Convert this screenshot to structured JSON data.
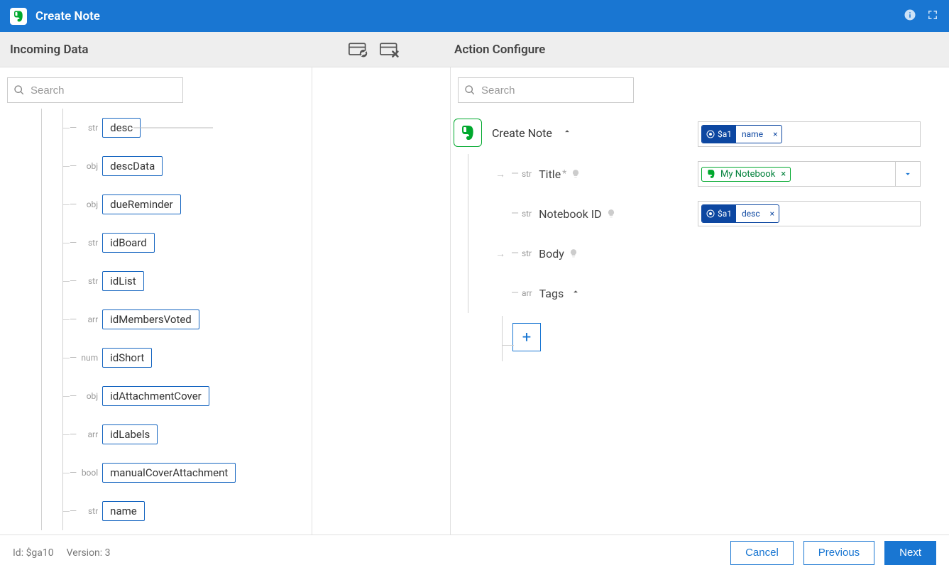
{
  "titlebar": {
    "title": "Create Note"
  },
  "sections": {
    "incoming": "Incoming Data",
    "configure": "Action Configure"
  },
  "search": {
    "placeholder": "Search"
  },
  "incoming_fields": [
    {
      "type": "str",
      "name": "desc"
    },
    {
      "type": "obj",
      "name": "descData"
    },
    {
      "type": "obj",
      "name": "dueReminder"
    },
    {
      "type": "str",
      "name": "idBoard"
    },
    {
      "type": "str",
      "name": "idList"
    },
    {
      "type": "arr",
      "name": "idMembersVoted"
    },
    {
      "type": "num",
      "name": "idShort"
    },
    {
      "type": "obj",
      "name": "idAttachmentCover"
    },
    {
      "type": "arr",
      "name": "idLabels"
    },
    {
      "type": "bool",
      "name": "manualCoverAttachment"
    },
    {
      "type": "str",
      "name": "name"
    }
  ],
  "action": {
    "name": "Create Note",
    "fields": {
      "title": {
        "type": "str",
        "label": "Title",
        "required": true
      },
      "notebook": {
        "type": "str",
        "label": "Notebook ID"
      },
      "body": {
        "type": "str",
        "label": "Body"
      },
      "tags": {
        "type": "arr",
        "label": "Tags"
      }
    }
  },
  "values": {
    "title_token": {
      "ref": "$a1",
      "field": "name"
    },
    "notebook_token": {
      "label": "My Notebook"
    },
    "body_token": {
      "ref": "$a1",
      "field": "desc"
    }
  },
  "footer": {
    "id_label": "Id: $ga10",
    "version_label": "Version: 3",
    "cancel": "Cancel",
    "previous": "Previous",
    "next": "Next"
  }
}
